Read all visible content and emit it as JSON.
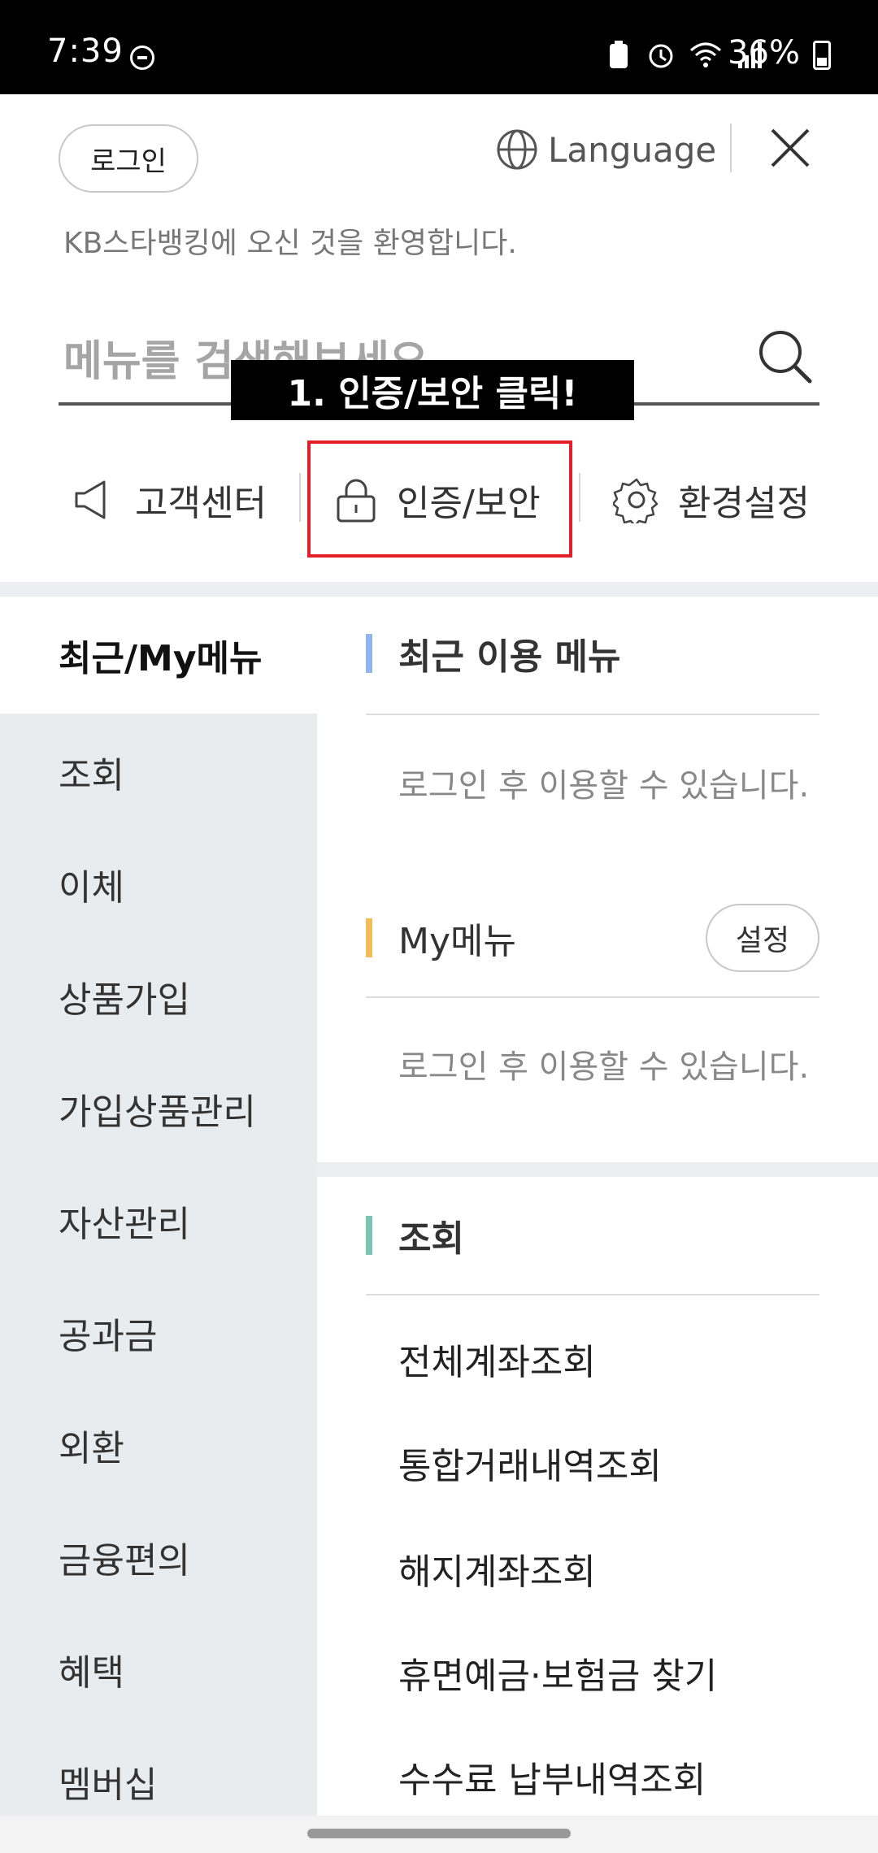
{
  "status_bar": {
    "time": "7:39",
    "battery": "36%"
  },
  "header": {
    "login_label": "로그인",
    "language_label": "Language",
    "welcome": "KB스타뱅킹에 오신 것을 환영합니다."
  },
  "search": {
    "placeholder": "메뉴를 검색해보세요"
  },
  "tutorial_label": "1. 인증/보안 클릭!",
  "quick_menu": [
    {
      "label": "고객센터",
      "icon": "megaphone-icon"
    },
    {
      "label": "인증/보안",
      "icon": "lock-icon"
    },
    {
      "label": "환경설정",
      "icon": "gear-icon"
    }
  ],
  "left_nav": [
    {
      "label": "최근/My메뉴",
      "active": true
    },
    {
      "label": "조회"
    },
    {
      "label": "이체"
    },
    {
      "label": "상품가입"
    },
    {
      "label": "가입상품관리"
    },
    {
      "label": "자산관리"
    },
    {
      "label": "공과금"
    },
    {
      "label": "외환"
    },
    {
      "label": "금융편의"
    },
    {
      "label": "혜택"
    },
    {
      "label": "멤버십"
    }
  ],
  "content": {
    "recent": {
      "title": "최근 이용 메뉴",
      "empty": "로그인 후 이용할 수 있습니다.",
      "accent": "#8fb6ec"
    },
    "my_menu": {
      "title": "My메뉴",
      "setting_label": "설정",
      "empty": "로그인 후 이용할 수 있습니다.",
      "accent": "#f2bd57"
    },
    "inquiry": {
      "title": "조회",
      "accent": "#7cc5b3",
      "items": [
        "전체계좌조회",
        "통합거래내역조회",
        "해지계좌조회",
        "휴면예금·보험금 찾기",
        "수수료 납부내역조회"
      ]
    }
  }
}
